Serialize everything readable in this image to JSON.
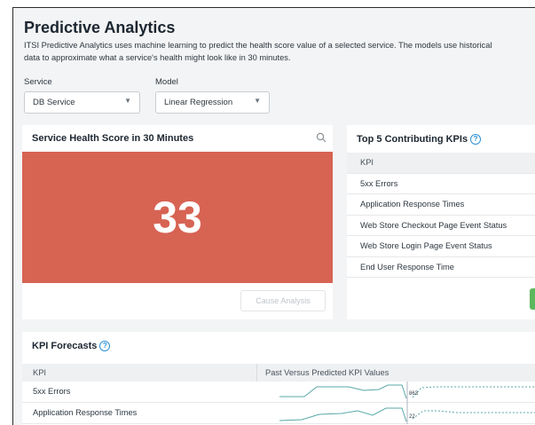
{
  "page": {
    "title": "Predictive Analytics",
    "description_line1": "ITSI Predictive Analytics uses machine learning to predict the health score value of a selected service. The models use historical",
    "description_line2": "data to approximate what a service's health might look like in 30 minutes."
  },
  "filters": {
    "service_label": "Service",
    "service_value": "DB Service",
    "model_label": "Model",
    "model_value": "Linear Regression"
  },
  "health_panel": {
    "title": "Service Health Score in 30 Minutes",
    "score": "33",
    "cause_button": "Cause Analysis",
    "score_color": "#d76353"
  },
  "kpi_panel": {
    "title": "Top 5 Contributing KPIs",
    "column_header": "KPI",
    "rows": [
      "5xx Errors",
      "Application Response Times",
      "Web Store Checkout Page Event Status",
      "Web Store Login Page Event Status",
      "End User Response Time"
    ]
  },
  "forecast_panel": {
    "title": "KPI Forecasts",
    "col_kpi": "KPI",
    "col_values": "Past Versus Predicted KPI Values",
    "rows": [
      {
        "kpi": "5xx Errors",
        "value_label": "863"
      },
      {
        "kpi": "Application Response Times",
        "value_label": "22"
      }
    ]
  },
  "icons": {
    "help": "help-circle-icon",
    "search": "search-icon",
    "dropdown": "chevron-down-icon"
  },
  "colors": {
    "accent_blue": "#2b8fd6",
    "success_green": "#5cb85c",
    "sparkline": "#5aa8a8"
  }
}
